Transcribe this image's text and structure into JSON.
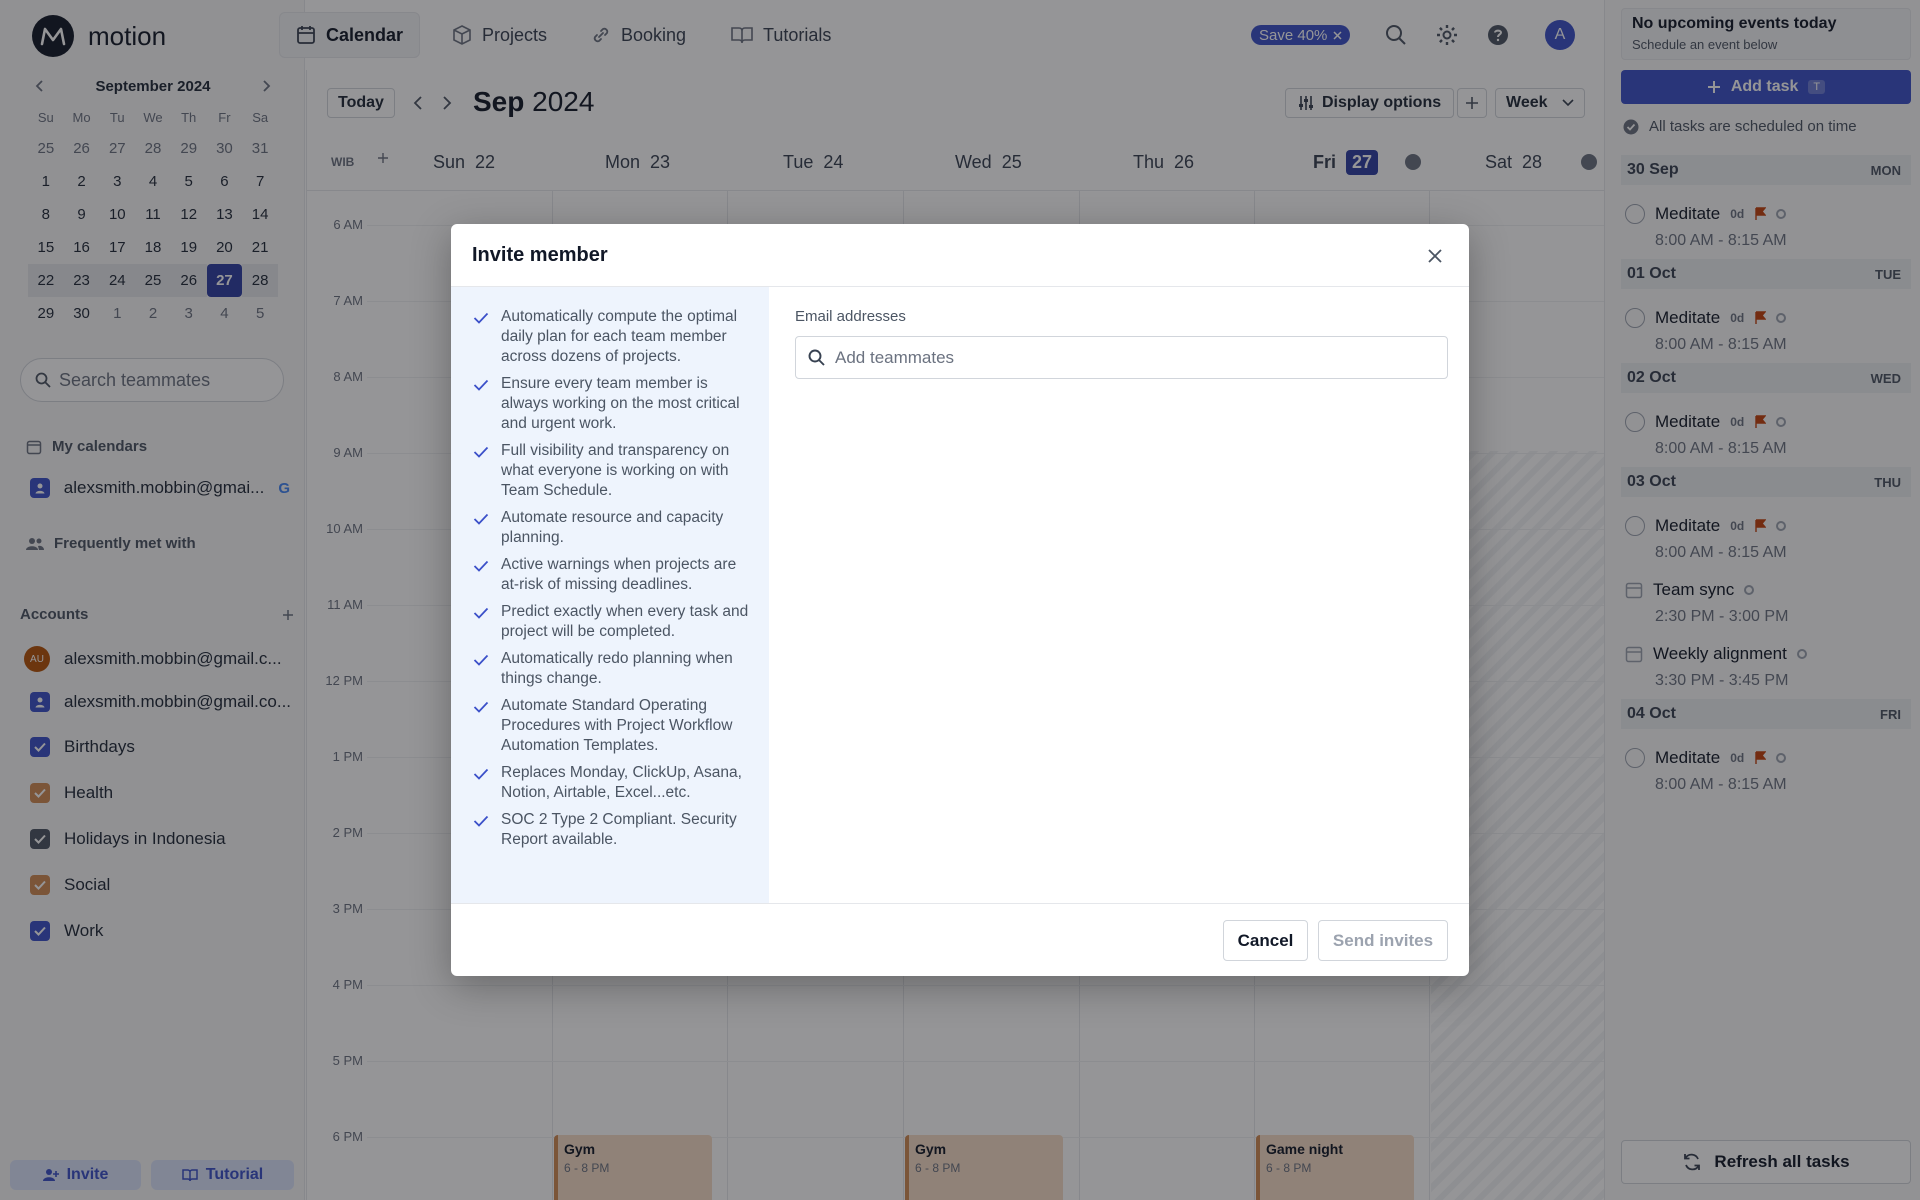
{
  "app": {
    "logo_text": "motion"
  },
  "nav": {
    "tabs": [
      {
        "label": "Calendar",
        "icon": "calendar-icon",
        "active": true
      },
      {
        "label": "Projects",
        "icon": "box-icon",
        "active": false
      },
      {
        "label": "Booking",
        "icon": "link-icon",
        "active": false
      },
      {
        "label": "Tutorials",
        "icon": "book-icon",
        "active": false
      }
    ],
    "save_badge": "Save 40%",
    "user_initial": "A"
  },
  "mini_calendar": {
    "title": "September 2024",
    "weekdays": [
      "Su",
      "Mo",
      "Tu",
      "We",
      "Th",
      "Fr",
      "Sa"
    ],
    "weeks": [
      [
        "25",
        "26",
        "27",
        "28",
        "29",
        "30",
        "31"
      ],
      [
        "1",
        "2",
        "3",
        "4",
        "5",
        "6",
        "7"
      ],
      [
        "8",
        "9",
        "10",
        "11",
        "12",
        "13",
        "14"
      ],
      [
        "15",
        "16",
        "17",
        "18",
        "19",
        "20",
        "21"
      ],
      [
        "22",
        "23",
        "24",
        "25",
        "26",
        "27",
        "28"
      ],
      [
        "29",
        "30",
        "1",
        "2",
        "3",
        "4",
        "5"
      ]
    ],
    "today": "27"
  },
  "sidebar": {
    "search_placeholder": "Search teammates",
    "my_calendars_label": "My calendars",
    "my_calendar_item": "alexsmith.mobbin@gmai...",
    "frequently_met_label": "Frequently met with",
    "accounts_label": "Accounts",
    "account_1": "alexsmith.mobbin@gmail.c...",
    "account_1_initials": "AU",
    "account_2": "alexsmith.mobbin@gmail.co...",
    "calendars": [
      {
        "label": "Birthdays",
        "color": "#3b50c9"
      },
      {
        "label": "Health",
        "color": "#d08a53"
      },
      {
        "label": "Holidays in Indonesia",
        "color": "#4b5563"
      },
      {
        "label": "Social",
        "color": "#d08a53"
      },
      {
        "label": "Work",
        "color": "#3b50c9"
      }
    ],
    "invite_label": "Invite",
    "tutorial_label": "Tutorial"
  },
  "calendar": {
    "today_label": "Today",
    "month_bold": "Sep",
    "year": "2024",
    "display_options_label": "Display options",
    "view_label": "Week",
    "timezone": "WIB",
    "days": [
      {
        "dow": "Sun",
        "num": "22"
      },
      {
        "dow": "Mon",
        "num": "23"
      },
      {
        "dow": "Tue",
        "num": "24"
      },
      {
        "dow": "Wed",
        "num": "25"
      },
      {
        "dow": "Thu",
        "num": "26"
      },
      {
        "dow": "Fri",
        "num": "27"
      },
      {
        "dow": "Sat",
        "num": "28"
      }
    ],
    "hours": [
      "6 AM",
      "7 AM",
      "8 AM",
      "9 AM",
      "10 AM",
      "11 AM",
      "12 PM",
      "1 PM",
      "2 PM",
      "3 PM",
      "4 PM",
      "5 PM",
      "6 PM"
    ],
    "events": [
      {
        "title": "Gym",
        "time": "6 - 8 PM"
      },
      {
        "title": "Gym",
        "time": "6 - 8 PM"
      },
      {
        "title": "Game night",
        "time": "6 - 8 PM"
      }
    ]
  },
  "right_panel": {
    "no_events_title": "No upcoming events today",
    "no_events_sub": "Schedule an event below",
    "add_task_label": "Add task",
    "add_task_key": "T",
    "scheduled_note": "All tasks are scheduled on time",
    "days": [
      {
        "date": "30",
        "month": "Sep",
        "dow": "MON"
      },
      {
        "date": "01",
        "month": "Oct",
        "dow": "TUE"
      },
      {
        "date": "02",
        "month": "Oct",
        "dow": "WED"
      },
      {
        "date": "03",
        "month": "Oct",
        "dow": "THU"
      },
      {
        "date": "04",
        "month": "Oct",
        "dow": "FRI"
      }
    ],
    "tasks": [
      {
        "title": "Meditate",
        "duration": "0d",
        "time": "8:00 AM - 8:15 AM"
      },
      {
        "title": "Meditate",
        "duration": "0d",
        "time": "8:00 AM - 8:15 AM"
      },
      {
        "title": "Meditate",
        "duration": "0d",
        "time": "8:00 AM - 8:15 AM"
      },
      {
        "title": "Meditate",
        "duration": "0d",
        "time": "8:00 AM - 8:15 AM"
      },
      {
        "title": "Team sync",
        "time": "2:30 PM - 3:00 PM"
      },
      {
        "title": "Weekly alignment",
        "time": "3:30 PM - 3:45 PM"
      },
      {
        "title": "Meditate",
        "duration": "0d",
        "time": "8:00 AM - 8:15 AM"
      }
    ],
    "refresh_label": "Refresh all tasks"
  },
  "modal": {
    "title": "Invite member",
    "benefits": [
      "Automatically compute the optimal daily plan for each team member across dozens of projects.",
      "Ensure every team member is always working on the most critical and urgent work.",
      "Full visibility and transparency on what everyone is working on with Team Schedule.",
      "Automate resource and capacity planning.",
      "Active warnings when projects are at-risk of missing deadlines.",
      "Predict exactly when every task and project will be completed.",
      "Automatically redo planning when things change.",
      "Automate Standard Operating Procedures with Project Workflow Automation Templates.",
      "Replaces Monday, ClickUp, Asana, Notion, Airtable, Excel...etc.",
      "SOC 2 Type 2 Compliant. Security Report available."
    ],
    "email_label": "Email addresses",
    "email_placeholder": "Add teammates",
    "email_value": "",
    "cancel_label": "Cancel",
    "send_label": "Send invites"
  }
}
